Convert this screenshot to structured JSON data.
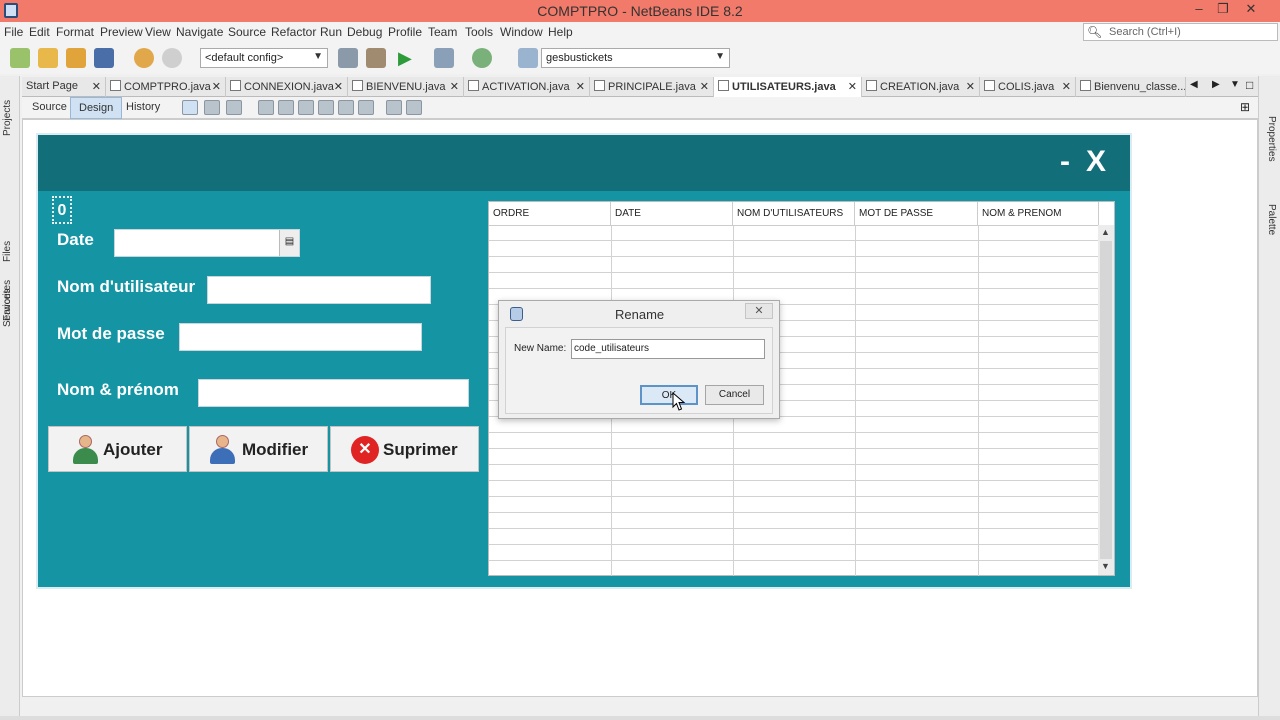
{
  "window": {
    "title": "COMPTPRO - NetBeans IDE 8.2",
    "controls": [
      "–",
      "❐",
      "✕"
    ]
  },
  "menu": [
    "File",
    "Edit",
    "Format",
    "Preview",
    "View",
    "Navigate",
    "Source",
    "Refactor",
    "Run",
    "Debug",
    "Profile",
    "Team",
    "Tools",
    "Window",
    "Help"
  ],
  "search": {
    "placeholder": "Search (Ctrl+I)"
  },
  "toolbar": {
    "config": "<default config>",
    "project": "gesbustickets"
  },
  "sidebar_left": [
    "Projects",
    "Files",
    "Services",
    "Favorites"
  ],
  "sidebar_right": [
    "Properties",
    "Palette"
  ],
  "tabs": [
    {
      "label": "Start Page"
    },
    {
      "label": "COMPTPRO.java"
    },
    {
      "label": "CONNEXION.java"
    },
    {
      "label": "BIENVENU.java"
    },
    {
      "label": "ACTIVATION.java"
    },
    {
      "label": "PRINCIPALE.java"
    },
    {
      "label": "UTILISATEURS.java"
    },
    {
      "label": "CREATION.java"
    },
    {
      "label": "COLIS.java"
    },
    {
      "label": "Bienvenu_classe...."
    }
  ],
  "editor_tabs": {
    "source": "Source",
    "design": "Design",
    "history": "History"
  },
  "form": {
    "header_controls": {
      "minimize": "-",
      "close": "X"
    },
    "id_label": "0",
    "labels": {
      "date": "Date",
      "username": "Nom d'utilisateur",
      "password": "Mot de passe",
      "fullname": "Nom & prénom"
    },
    "buttons": {
      "add": "Ajouter",
      "edit": "Modifier",
      "delete": "Suprimer"
    }
  },
  "table": {
    "columns": [
      "ORDRE",
      "DATE",
      "NOM D'UTILISATEURS",
      "MOT DE PASSE",
      "NOM & PRENOM"
    ]
  },
  "dialog": {
    "title": "Rename",
    "field_label": "New Name:",
    "field_value": "code_utilisateurs",
    "ok": "OK",
    "cancel": "Cancel",
    "close": "✕"
  }
}
